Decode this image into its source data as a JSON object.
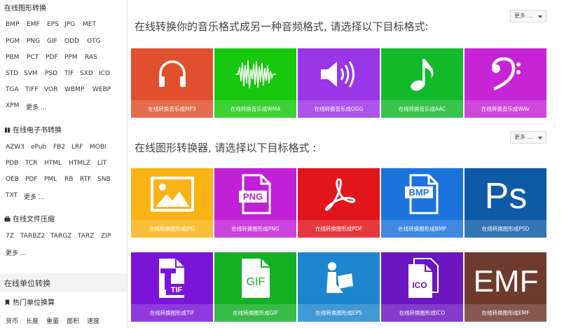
{
  "sidebar": {
    "graphics": {
      "title": "在线图形转换",
      "rows": [
        [
          "BMP",
          "EMF",
          "EPS",
          "JPG",
          "MET"
        ],
        [
          "PGM",
          "PNG",
          "GIF",
          "ODD",
          "OTG"
        ],
        [
          "PBM",
          "PCT",
          "PDF",
          "PPM",
          "RAS"
        ],
        [
          "STD",
          "SVM",
          "PSD",
          "TIF",
          "SXD",
          "ICO"
        ],
        [
          "TGA",
          "TIFF",
          "VOR",
          "WBMP",
          "WEBP"
        ],
        [
          "XPM",
          "更多 ..."
        ]
      ]
    },
    "ebook": {
      "title": "在线电子书转换",
      "rows": [
        [
          "AZW3",
          "ePub",
          "FB2",
          "LRF",
          "MOBI"
        ],
        [
          "PDB",
          "TCR",
          "HTML",
          "HTMLZ",
          "LIT"
        ],
        [
          "OEB",
          "PDF",
          "PML",
          "RB",
          "RTF",
          "SNB"
        ],
        [
          "TXT",
          "更多 ..."
        ]
      ]
    },
    "archive": {
      "title": "在线文件压缩",
      "rows": [
        [
          "7Z",
          "TARBZ2",
          "TARGZ",
          "TARZ",
          "ZIP"
        ],
        [
          "更多 ..."
        ]
      ]
    },
    "units": {
      "title": "在线单位转换",
      "popular_title": "热门单位换算",
      "items": [
        "货币",
        "长度",
        "重量",
        "面积",
        "速度"
      ]
    }
  },
  "audio_section": {
    "title": "在线转换你的音乐格式成另一种音频格式, 请选择以下目标格式:",
    "more": "更多 ...",
    "tiles": [
      {
        "label": "在线转换音乐成MP3",
        "color": "#e0502e",
        "icon": "headphones-icon"
      },
      {
        "label": "在线转换音乐成WMA",
        "color": "#17c80f",
        "icon": "waveform-icon"
      },
      {
        "label": "在线转换音乐成OGG",
        "color": "#9b35e8",
        "icon": "speaker-icon"
      },
      {
        "label": "在线转换音乐成AAC",
        "color": "#13b92a",
        "icon": "music-note-icon"
      },
      {
        "label": "在线转换音乐成WAV",
        "color": "#c624d6",
        "icon": "bass-clef-icon"
      }
    ]
  },
  "image_section": {
    "title": "在线图形转换器, 请选择以下目标格式 :",
    "more": "更多 ...",
    "tiles": [
      {
        "label": "在线转换图形成JPG",
        "color": "#f9b314",
        "icon": "picture-icon"
      },
      {
        "label": "在线转换图形成PNG",
        "color": "#c021d6",
        "icon": "png-file-icon",
        "badge": "PNG"
      },
      {
        "label": "在线转换图形成PDF",
        "color": "#e3151c",
        "icon": "pdf-icon"
      },
      {
        "label": "在线转换图形成BMP",
        "color": "#1c73dc",
        "icon": "bmp-file-icon",
        "badge": "BMP"
      },
      {
        "label": "在线转换图形成PSD",
        "color": "#0e5aa6",
        "icon": "photoshop-icon",
        "badge": "Ps"
      }
    ]
  },
  "image_section_2": {
    "tiles": [
      {
        "label": "在线转换图形成TIF",
        "color": "#7a15d8",
        "icon": "tif-file-icon",
        "badge": "TIF"
      },
      {
        "label": "在线转换图形成GIF",
        "color": "#13b024",
        "icon": "gif-file-icon",
        "badge": "GIF"
      },
      {
        "label": "在线转换图形成EPS",
        "color": "#1d86cf",
        "icon": "reader-icon"
      },
      {
        "label": "在线转换图形成ICO",
        "color": "#6c16c2",
        "icon": "ico-file-icon",
        "badge": "ICO"
      },
      {
        "label": "在线转换图形成EMF",
        "color": "#6e3a2e",
        "icon": "emf-text-icon",
        "badge": "EMF"
      }
    ]
  }
}
